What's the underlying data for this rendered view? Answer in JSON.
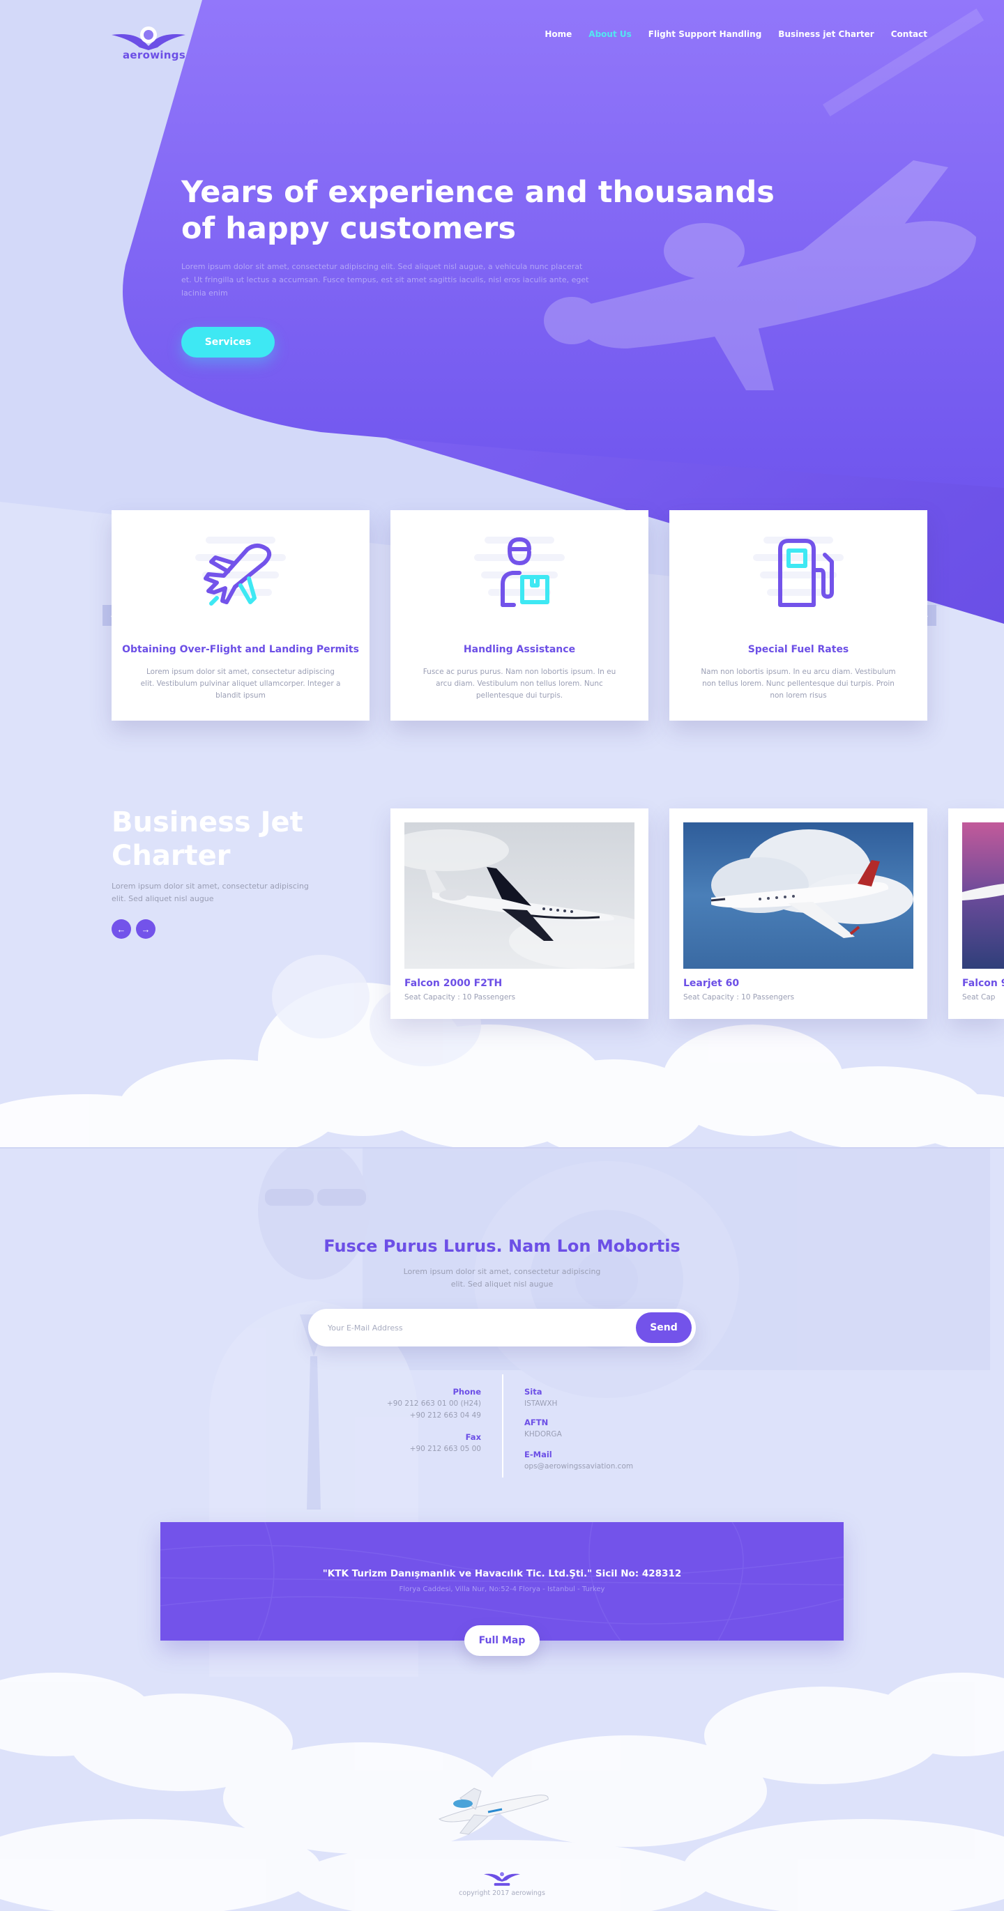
{
  "brand": {
    "name": "aerowings"
  },
  "nav": {
    "items": [
      {
        "label": "Home",
        "active": false
      },
      {
        "label": "About Us",
        "active": true
      },
      {
        "label": "Flight Support Handling",
        "active": false
      },
      {
        "label": "Business jet Charter",
        "active": false
      },
      {
        "label": "Contact",
        "active": false
      }
    ]
  },
  "hero": {
    "title": "Years of experience and thousands of happy customers",
    "text": "Lorem ipsum dolor sit amet, consectetur adipiscing elit. Sed aliquet nisl augue, a vehicula nunc placerat et. Ut fringilla ut lectus a accumsan. Fusce tempus, est sit amet sagittis iaculis, nisl eros iaculis ante, eget lacinia enim",
    "button": "Services"
  },
  "services": {
    "cards": [
      {
        "icon": "airplane-icon",
        "title": "Obtaining Over-Flight and Landing Permits",
        "text": "Lorem ipsum dolor sit amet, consectetur adipiscing elit. Vestibulum pulvinar aliquet ullamcorper. Integer a blandit ipsum"
      },
      {
        "icon": "handler-package-icon",
        "title": "Handling Assistance",
        "text": "Fusce ac purus purus. Nam non lobortis ipsum. In eu arcu diam. Vestibulum non tellus lorem. Nunc pellentesque dui turpis."
      },
      {
        "icon": "fuel-pump-icon",
        "title": "Special Fuel Rates",
        "text": "Nam non lobortis ipsum. In eu arcu diam. Vestibulum non tellus lorem. Nunc pellentesque dui turpis. Proin non lorem risus"
      }
    ],
    "prev_arrow": "‹",
    "next_arrow": "›"
  },
  "charter": {
    "title": "Business Jet Charter",
    "text": "Lorem ipsum dolor sit amet, consectetur adipiscing elit. Sed aliquet nisl augue",
    "prev": "←",
    "next": "→",
    "jets": [
      {
        "name": "Falcon 2000 F2TH",
        "seat": "Seat Capacity : 10 Passengers"
      },
      {
        "name": "Learjet 60",
        "seat": "Seat Capacity : 10 Passengers"
      },
      {
        "name": "Falcon 9",
        "seat": "Seat Cap"
      }
    ]
  },
  "contact": {
    "title": "Fusce Purus Lurus. Nam Lon Mobortis",
    "text": "Lorem ipsum dolor sit amet, consectetur adipiscing elit. Sed aliquet nisl augue",
    "email_placeholder": "Your E-Mail Address",
    "send": "Send",
    "phone_label": "Phone",
    "phone_1": "+90 212 663 01 00 (H24)",
    "phone_2": "+90 212 663 04 49",
    "fax_label": "Fax",
    "fax": "+90 212 663 05 00",
    "sita_label": "Sita",
    "sita": "ISTAWXH",
    "aftn_label": "AFTN",
    "aftn": "KHDORGA",
    "email_label": "E-Mail",
    "email": "ops@aerowingssaviation.com"
  },
  "address": {
    "title": "\"KTK Turizm Danışmanlık ve Havacılık Tic. Ltd.Şti.\" Sicil No: 428312",
    "line": "Florya Caddesi, Villa Nur, No:52-4 Florya  -  Istanbul  - Turkey",
    "map_button": "Full Map"
  },
  "footer": {
    "copyright": "copyright 2017 aerowings"
  },
  "colors": {
    "primary": "#7353ea",
    "accent": "#3ee8f3",
    "background": "#dde2fa",
    "text_muted": "#9a9eb4"
  }
}
